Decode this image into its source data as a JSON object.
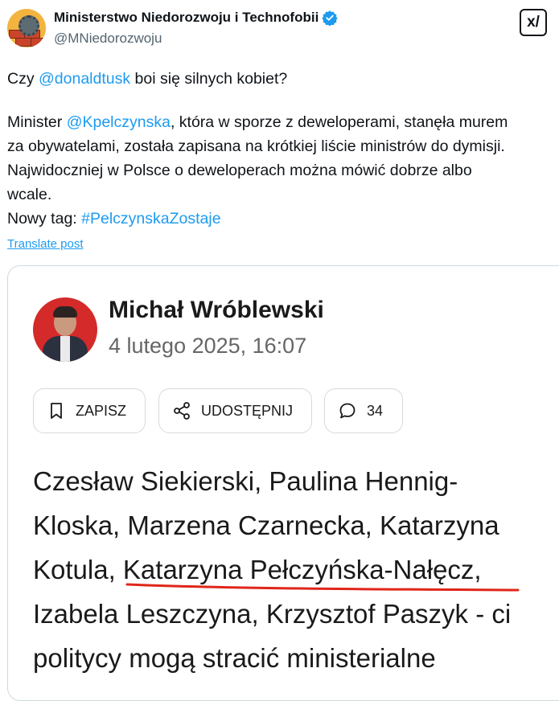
{
  "account": {
    "display_name": "Ministerstwo Niedorozwoju i Technofobii",
    "handle": "@MNiedorozwoju",
    "avatar_icon": "brick-wall-gear-avatar",
    "verified_icon": "verified-badge-icon",
    "verified_color": "#1d9bf0"
  },
  "grok_button": {
    "label": "x/",
    "icon": "grok-icon"
  },
  "post": {
    "line1": {
      "a": "Czy ",
      "mention": "@donaldtusk",
      "b": " boi się silnych kobiet?"
    },
    "line2": {
      "a": "Minister ",
      "mention": "@Kpelczynska",
      "b": ", która w sporze z deweloperami, stanęła murem"
    },
    "line3": "za obywatelami, została zapisana na krótkiej liście ministrów do dymisji.",
    "line4": "Najwidoczniej w Polsce o deweloperach można mówić dobrze albo",
    "line5": "wcale.",
    "line6": {
      "a": "Nowy tag: ",
      "hashtag": "#PelczynskaZostaje"
    },
    "translate": "Translate post",
    "link_color": "#1d9bf0"
  },
  "embedded": {
    "author_name": "Michał Wróblewski",
    "date": "4 lutego 2025, 16:07",
    "buttons": {
      "save": "ZAPISZ",
      "share": "UDOSTĘPNIJ",
      "comments": "34"
    },
    "article_lines": [
      "Czesław Siekierski, Paulina Hennig-",
      "Kloska, Marzena Czarnecka, Katarzyna",
      "Kotula, Katarzyna Pełczyńska-Nałęcz,",
      "Izabela Leszczyna, Krzysztof Paszyk - ci",
      "politycy mogą stracić ministerialne"
    ],
    "underline_color": "#e0261a"
  }
}
